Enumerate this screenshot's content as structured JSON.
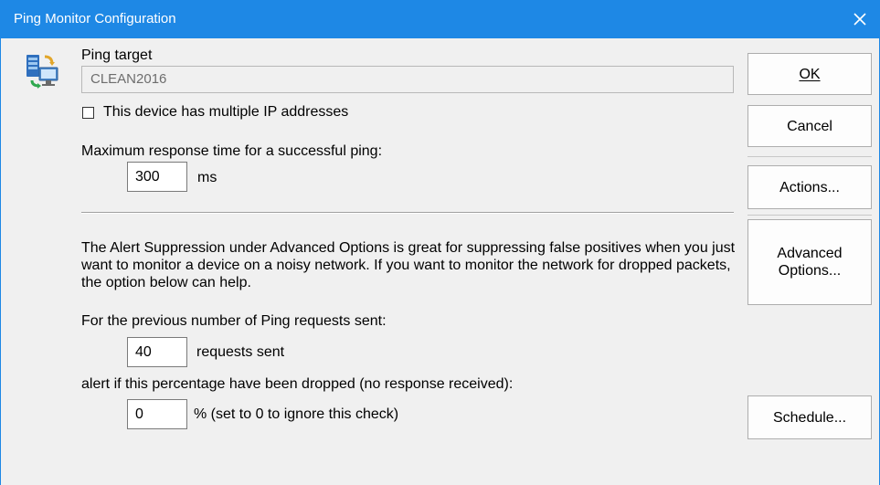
{
  "window": {
    "title": "Ping Monitor Configuration"
  },
  "ping_target": {
    "label": "Ping target",
    "value": "CLEAN2016"
  },
  "multiple_ip": {
    "label": "This device has multiple IP addresses",
    "checked": false
  },
  "response_time": {
    "label": "Maximum response time for a successful ping:",
    "value": "300",
    "unit": "ms"
  },
  "description": "The Alert Suppression under Advanced Options is great for suppressing false positives when you just want to monitor a device on a noisy network.  If you want to monitor the network for dropped packets, the option below can help.",
  "requests": {
    "label": "For the previous number of Ping requests sent:",
    "value": "40",
    "unit": "requests sent"
  },
  "dropped": {
    "label": "alert if this percentage have been dropped (no response received):",
    "value": "0",
    "unit": "%  (set to 0 to ignore this check)"
  },
  "buttons": {
    "ok": "OK",
    "cancel": "Cancel",
    "actions": "Actions...",
    "advanced": "Advanced Options...",
    "schedule": "Schedule..."
  },
  "colors": {
    "titlebar": "#1e88e5",
    "dialog_bg": "#f0f0f0"
  },
  "icons": {
    "app": "server-monitor-icon",
    "close": "close-icon"
  }
}
